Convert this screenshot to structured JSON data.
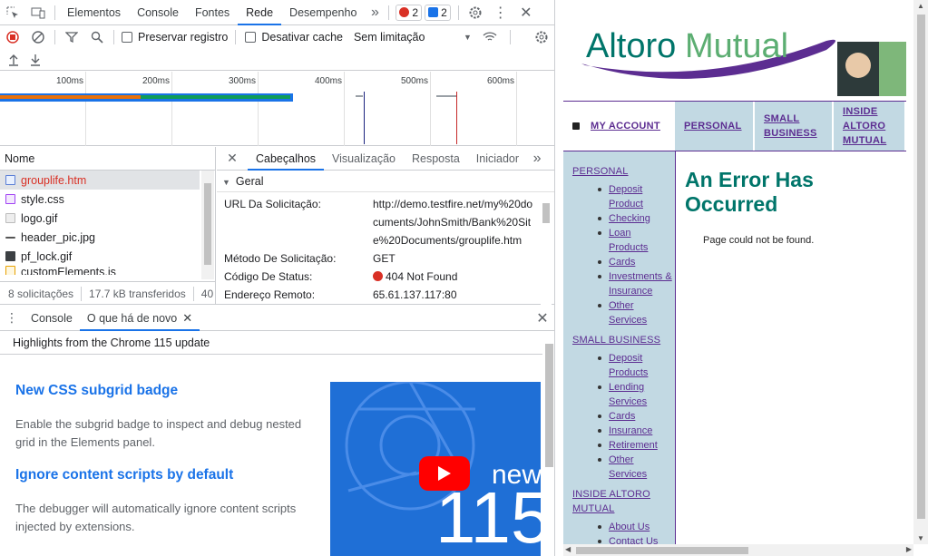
{
  "devtools": {
    "tabs": [
      "Elementos",
      "Console",
      "Fontes",
      "Rede",
      "Desempenho"
    ],
    "active_tab": "Rede",
    "more_tabs_label": "»",
    "error_count": "2",
    "message_count": "2",
    "toolbar": {
      "preserve_log": "Preservar registro",
      "disable_cache": "Desativar cache",
      "throttling": "Sem limitação"
    },
    "timeline_ticks": [
      "100ms",
      "200ms",
      "300ms",
      "400ms",
      "500ms",
      "600ms"
    ],
    "request_list": {
      "header": "Nome",
      "items": [
        "grouplife.htm",
        "style.css",
        "logo.gif",
        "header_pic.jpg",
        "pf_lock.gif",
        "customElements.js"
      ],
      "status": "8 solicitações",
      "transferred": "17.7 kB transferidos",
      "extra": "40"
    },
    "detail_tabs": [
      "Cabeçalhos",
      "Visualização",
      "Resposta",
      "Iniciador"
    ],
    "active_detail_tab": "Cabeçalhos",
    "section_title": "Geral",
    "headers": [
      {
        "key": "URL Da Solicitação:",
        "value": "http://demo.testfire.net/my%20documents/JohnSmith/Bank%20Site%20Documents/grouplife.htm"
      },
      {
        "key": "Método De Solicitação:",
        "value": "GET"
      },
      {
        "key": "Código De Status:",
        "value": "404 Not Found"
      },
      {
        "key": "Endereço Remoto:",
        "value": "65.61.137.117:80"
      }
    ],
    "drawer": {
      "tabs": [
        "Console",
        "O que há de novo"
      ],
      "active_tab": "O que há de novo",
      "highlights": "Highlights from the Chrome 115 update",
      "items": [
        {
          "title": "New CSS subgrid badge",
          "body": "Enable the subgrid badge to inspect and debug nested grid in the Elements panel."
        },
        {
          "title": "Ignore content scripts by default",
          "body": "The debugger will automatically ignore content scripts injected by extensions."
        }
      ],
      "video_text": "new",
      "video_number": "115"
    }
  },
  "site": {
    "logo_part1": "Altoro",
    "logo_part2": "Mutual",
    "top_nav": [
      "MY ACCOUNT",
      "PERSONAL",
      "SMALL BUSINESS",
      "INSIDE ALTORO MUTUAL"
    ],
    "left_nav": [
      {
        "section": "PERSONAL",
        "items": [
          "Deposit Product",
          "Checking",
          "Loan Products",
          "Cards",
          "Investments & Insurance",
          "Other Services"
        ]
      },
      {
        "section": "SMALL BUSINESS",
        "items": [
          "Deposit Products",
          "Lending Services",
          "Cards",
          "Insurance",
          "Retirement",
          "Other Services"
        ]
      },
      {
        "section": "INSIDE ALTORO MUTUAL",
        "items": [
          "About Us",
          "Contact Us"
        ]
      }
    ],
    "error_title": "An Error Has Occurred",
    "error_message": "Page could not be found."
  },
  "colors": {
    "accent": "#1a73e8",
    "brand_purple": "#5c2d91",
    "brand_teal": "#00756a",
    "nav_bg": "#c2d9e3",
    "error_red": "#d93025"
  }
}
